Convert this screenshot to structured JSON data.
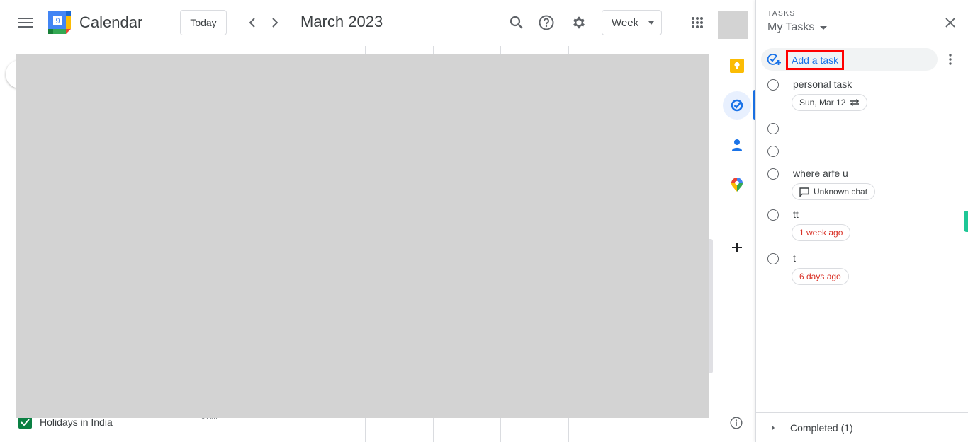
{
  "header": {
    "app_title": "Calendar",
    "logo_day": "9",
    "today_label": "Today",
    "period_title": "March 2023",
    "view_selected": "Week",
    "icons": {
      "menu": "hamburger-menu-icon",
      "prev": "chevron-left-icon",
      "next": "chevron-right-icon",
      "search": "search-icon",
      "help": "help-circle-icon",
      "settings": "gear-icon",
      "apps": "apps-grid-icon"
    }
  },
  "main": {
    "calendars": [
      {
        "label": "Holidays in India",
        "checked": true,
        "color": "#0b8043"
      }
    ],
    "time_label": "9 AM"
  },
  "side_rail": {
    "items": [
      {
        "name": "keep",
        "icon": "keep-bulb-icon",
        "color": "#fbbc04"
      },
      {
        "name": "tasks",
        "icon": "tasks-check-icon",
        "color": "#1a73e8",
        "active": true
      },
      {
        "name": "contacts",
        "icon": "contacts-person-icon",
        "color": "#1a73e8"
      },
      {
        "name": "maps",
        "icon": "maps-pin-icon"
      }
    ],
    "add_icon": "plus-icon",
    "info_icon": "info-icon"
  },
  "tasks": {
    "eyebrow": "TASKS",
    "list_name": "My Tasks",
    "add_task_label": "Add a task",
    "items": [
      {
        "title": "personal task",
        "chip": "Sun, Mar 12",
        "chip_icon": "repeat-icon",
        "overdue": false
      },
      {
        "title": "",
        "chip": null
      },
      {
        "title": "",
        "chip": null
      },
      {
        "title": "where arfe u",
        "chip": "Unknown chat",
        "chip_icon": "chat-icon",
        "overdue": false
      },
      {
        "title": "tt",
        "chip": "1 week ago",
        "overdue": true
      },
      {
        "title": "t",
        "chip": "6 days ago",
        "overdue": true
      }
    ],
    "completed_label": "Completed (1)"
  },
  "colors": {
    "accent": "#1a73e8",
    "overdue": "#d93025",
    "highlight_box": "#ff0000",
    "redacted": "#d3d3d3"
  }
}
